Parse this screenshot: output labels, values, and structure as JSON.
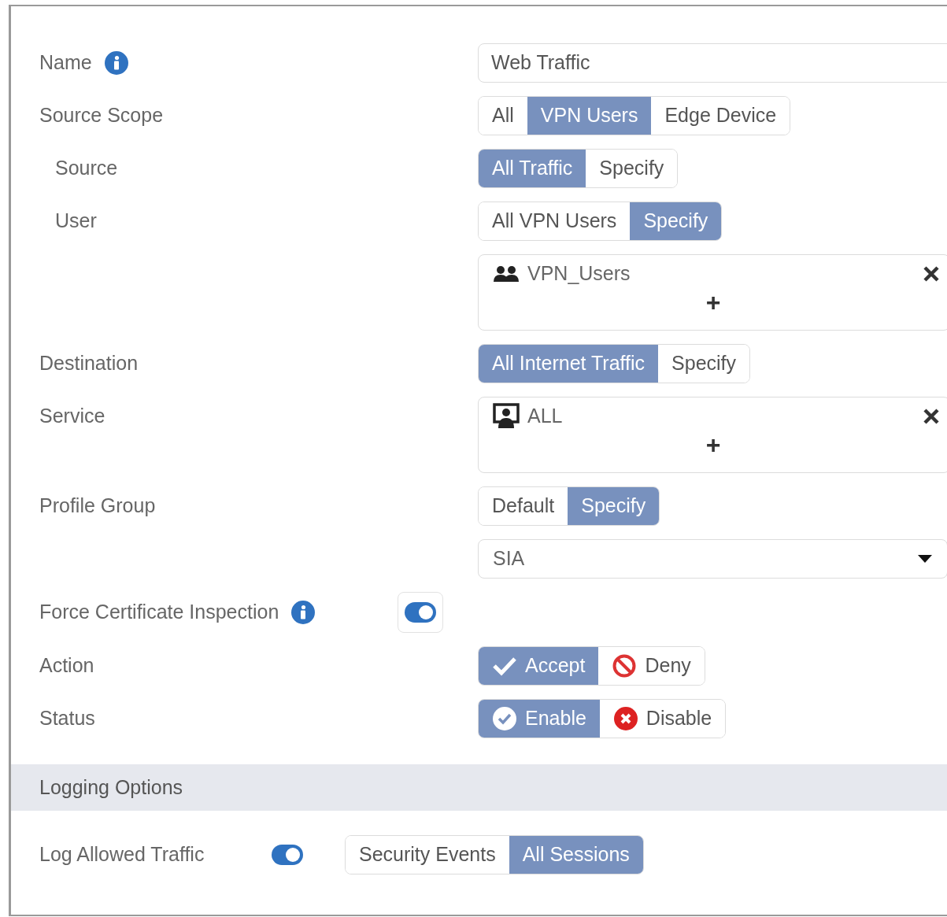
{
  "fields": [
    {
      "kind": "text",
      "label": "Name",
      "info": true,
      "value": "Web Traffic"
    },
    {
      "kind": "segmented",
      "label": "Source Scope",
      "info": false,
      "options": [
        {
          "label": "All",
          "selected": false
        },
        {
          "label": "VPN Users",
          "selected": true
        },
        {
          "label": "Edge Device",
          "selected": false
        }
      ],
      "children": [
        {
          "kind": "segmented",
          "label": "Source",
          "info": false,
          "options": [
            {
              "label": "All Traffic",
              "selected": true
            },
            {
              "label": "Specify",
              "selected": false
            }
          ]
        },
        {
          "kind": "segmented",
          "label": "User",
          "info": false,
          "options": [
            {
              "label": "All VPN Users",
              "selected": false
            },
            {
              "label": "Specify",
              "selected": true
            }
          ]
        },
        {
          "kind": "list",
          "entries": [
            {
              "kind": "user-group",
              "label": "VPN_Users"
            }
          ],
          "add_label": "+"
        }
      ]
    },
    {
      "kind": "segmented",
      "label": "Destination",
      "info": false,
      "options": [
        {
          "label": "All Internet Traffic",
          "selected": true
        },
        {
          "label": "Specify",
          "selected": false
        }
      ]
    },
    {
      "kind": "list",
      "label": "Service",
      "info": false,
      "entries": [
        {
          "kind": "service",
          "label": "ALL"
        }
      ],
      "add_label": "+"
    },
    {
      "kind": "segmented",
      "label": "Profile Group",
      "info": false,
      "options": [
        {
          "label": "Default",
          "selected": false
        },
        {
          "label": "Specify",
          "selected": true
        }
      ]
    },
    {
      "kind": "select",
      "value": "SIA"
    },
    {
      "kind": "toggle",
      "label": "Force Certificate Inspection",
      "info": true,
      "on": true
    },
    {
      "kind": "segmented",
      "label": "Action",
      "info": false,
      "options": [
        {
          "label": "Accept",
          "selected": true,
          "kind": "accept"
        },
        {
          "label": "Deny",
          "selected": false,
          "kind": "deny"
        }
      ]
    },
    {
      "kind": "segmented",
      "label": "Status",
      "info": false,
      "options": [
        {
          "label": "Enable",
          "selected": true,
          "kind": "enable"
        },
        {
          "label": "Disable",
          "selected": false,
          "kind": "disable"
        }
      ]
    }
  ],
  "logging": {
    "title": "Logging Options",
    "fields": [
      {
        "kind": "toggle-segmented",
        "label": "Log Allowed Traffic",
        "on": true,
        "options": [
          {
            "label": "Security Events",
            "selected": false
          },
          {
            "label": "All Sessions",
            "selected": true
          }
        ]
      }
    ]
  }
}
